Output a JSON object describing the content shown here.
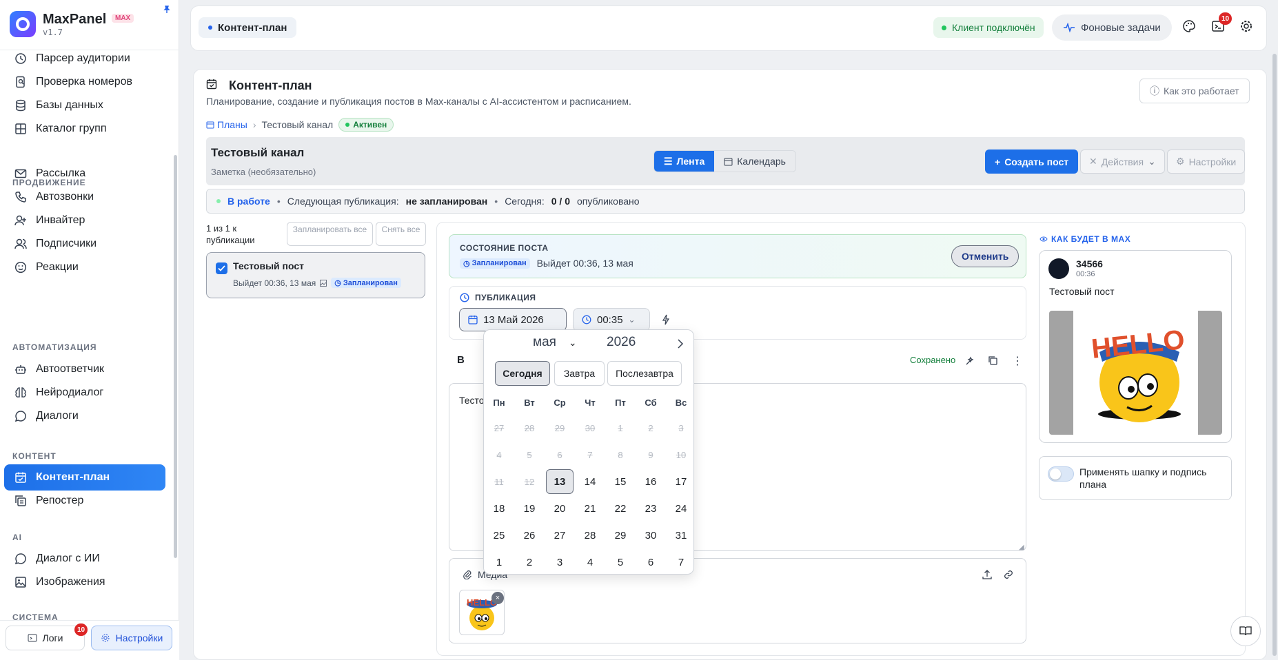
{
  "app": {
    "name": "MaxPanel",
    "version": "v1.7",
    "badge": "MAX"
  },
  "sidebar": {
    "items_top": [
      {
        "label": "Парсер аудитории",
        "icon": "history-icon"
      },
      {
        "label": "Проверка номеров",
        "icon": "phone-search-icon"
      },
      {
        "label": "Базы данных",
        "icon": "database-icon"
      },
      {
        "label": "Каталог групп",
        "icon": "grid-icon"
      }
    ],
    "sec_promo": "ПРОДВИЖЕНИЕ",
    "items_promo": [
      {
        "label": "Рассылка",
        "icon": "mail-icon"
      },
      {
        "label": "Автозвонки",
        "icon": "phone-icon"
      },
      {
        "label": "Инвайтер",
        "icon": "user-plus-icon"
      },
      {
        "label": "Подписчики",
        "icon": "users-icon"
      },
      {
        "label": "Реакции",
        "icon": "smile-icon"
      }
    ],
    "sec_auto": "АВТОМАТИЗАЦИЯ",
    "items_auto": [
      {
        "label": "Автоответчик",
        "icon": "bot-icon"
      },
      {
        "label": "Нейродиалог",
        "icon": "brain-icon"
      },
      {
        "label": "Диалоги",
        "icon": "chat-icon"
      }
    ],
    "sec_content": "КОНТЕНТ",
    "items_content": [
      {
        "label": "Контент-план",
        "icon": "calendar-check-icon"
      },
      {
        "label": "Репостер",
        "icon": "copy-icon"
      }
    ],
    "sec_ai": "AI",
    "items_ai": [
      {
        "label": "Диалог с ИИ",
        "icon": "chat-icon"
      },
      {
        "label": "Изображения",
        "icon": "image-icon"
      }
    ],
    "sec_sys": "СИСТЕМА",
    "logs": "Логи",
    "logs_count": "10",
    "settings": "Настройки"
  },
  "topbar": {
    "tab": "Контент-план",
    "client": "Клиент подключён",
    "bg_tasks": "Фоновые задачи",
    "terminal_count": "10"
  },
  "page": {
    "title": "Контент-план",
    "subtitle": "Планирование, создание и публикация постов в Max-каналы с AI-ассистентом и расписанием.",
    "how": "Как это работает",
    "crumb_plans": "Планы",
    "crumb_channel": "Тестовый канал",
    "status": "Активен",
    "channel": "Тестовый канал",
    "note": "Заметка (необязательно)",
    "view_feed": "Лента",
    "view_cal": "Календарь",
    "create": "Создать пост",
    "actions": "Действия",
    "settings": "Настройки",
    "st_work": "В работе",
    "st_next_lbl": "Следующая публикация:",
    "st_next_val": "не запланирован",
    "st_today_lbl": "Сегодня:",
    "st_today_val": "0 / 0",
    "st_pub": "опубликовано"
  },
  "list": {
    "count": "1 из 1 к публикации",
    "schedule_all": "Запланировать все",
    "unmark_all": "Снять все",
    "post_title": "Тестовый пост",
    "post_meta": "Выйдет 00:36, 13 мая",
    "post_status": "Запланирован"
  },
  "editor": {
    "state_title": "СОСТОЯНИЕ ПОСТА",
    "state_badge": "Запланирован",
    "state_text": "Выйдет 00:36, 13 мая",
    "cancel": "Отменить",
    "pub_title": "ПУБЛИКАЦИЯ",
    "date": "13 Май 2026",
    "time": "00:35",
    "bold": "B",
    "saved": "Сохранено",
    "text": "Тесто",
    "media": "Медиа"
  },
  "preview": {
    "label": "КАК БУДЕТ В MAX",
    "name": "34566",
    "time": "00:36",
    "text": "Тестовый пост",
    "toggle": "Применять шапку и подпись плана"
  },
  "calendar": {
    "month": "мая",
    "year": "2026",
    "quick": [
      "Сегодня",
      "Завтра",
      "Послезавтра"
    ],
    "dow": [
      "Пн",
      "Вт",
      "Ср",
      "Чт",
      "Пт",
      "Сб",
      "Вс"
    ],
    "weeks": [
      [
        "27",
        "28",
        "29",
        "30",
        "1",
        "2",
        "3"
      ],
      [
        "4",
        "5",
        "6",
        "7",
        "8",
        "9",
        "10"
      ],
      [
        "11",
        "12",
        "13",
        "14",
        "15",
        "16",
        "17"
      ],
      [
        "18",
        "19",
        "20",
        "21",
        "22",
        "23",
        "24"
      ],
      [
        "25",
        "26",
        "27",
        "28",
        "29",
        "30",
        "31"
      ],
      [
        "1",
        "2",
        "3",
        "4",
        "5",
        "6",
        "7"
      ]
    ],
    "disabled_count": 16,
    "today": "13"
  },
  "colors": {
    "accent": "#1d6fe8",
    "success": "#15803d",
    "danger": "#dc2626"
  }
}
